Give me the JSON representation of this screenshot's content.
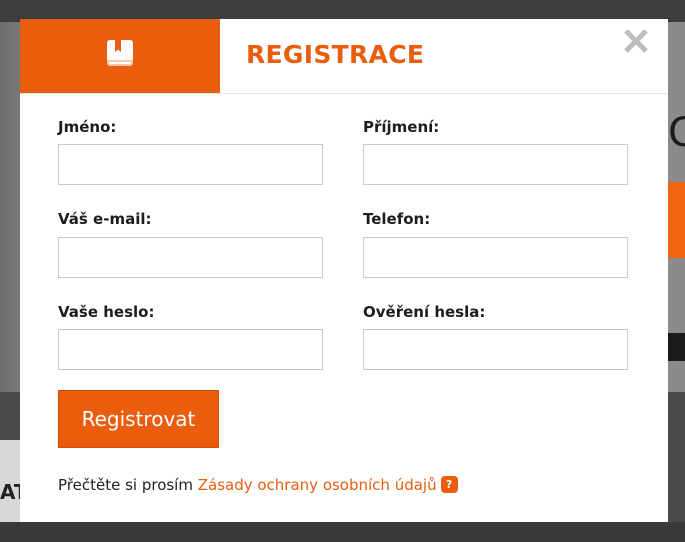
{
  "modal": {
    "title": "REGISTRACE",
    "header_icon": "book-icon",
    "close_icon": "close-icon",
    "accent_color": "#ea5d0c"
  },
  "form": {
    "first_name_label": "Jméno:",
    "last_name_label": "Příjmení:",
    "email_label": "Váš e-mail:",
    "phone_label": "Telefon:",
    "password_label": "Vaše heslo:",
    "password_confirm_label": "Ověření hesla:",
    "first_name_value": "",
    "last_name_value": "",
    "email_value": "",
    "phone_value": "",
    "password_value": "",
    "password_confirm_value": "",
    "submit_label": "Registrovat"
  },
  "privacy": {
    "prefix": "Přečtěte si prosím ",
    "link_text": "Zásady ochrany osobních údajů",
    "help_icon": "question-mark-icon",
    "help_glyph": "?"
  },
  "background": {
    "partial_text": "AT"
  }
}
